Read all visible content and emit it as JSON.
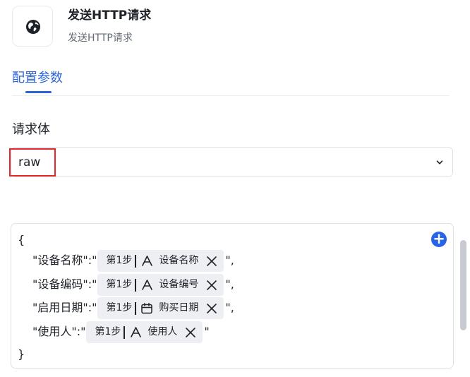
{
  "app": {
    "title": "发送HTTP请求",
    "subtitle": "发送HTTP请求",
    "icon": "globe-icon"
  },
  "tabs": [
    {
      "label": "配置参数",
      "active": true
    }
  ],
  "request_body": {
    "label": "请求体",
    "selected": "raw"
  },
  "editor": {
    "open_brace": "{",
    "close_brace": "}",
    "lines": [
      {
        "key_text": "\"设备名称\":\"",
        "chip": {
          "step": "第1步",
          "field_type_icon": "text-type-icon",
          "field_name": "设备名称"
        },
        "tail": "\","
      },
      {
        "key_text": "\"设备编码\":\"",
        "chip": {
          "step": "第1步",
          "field_type_icon": "text-type-icon",
          "field_name": "设备编号"
        },
        "tail": "\","
      },
      {
        "key_text": "\"启用日期\":\"",
        "chip": {
          "step": "第1步",
          "field_type_icon": "calendar-icon",
          "field_name": "购买日期"
        },
        "tail": "\","
      },
      {
        "key_text": "\"使用人\":\"",
        "chip": {
          "step": "第1步",
          "field_type_icon": "text-type-icon",
          "field_name": "使用人"
        },
        "tail": "\""
      }
    ]
  },
  "colors": {
    "accent": "#2b63d9",
    "highlight": "#e3262f",
    "chip_background": "#edeff2",
    "add_button": "#2665ea"
  }
}
